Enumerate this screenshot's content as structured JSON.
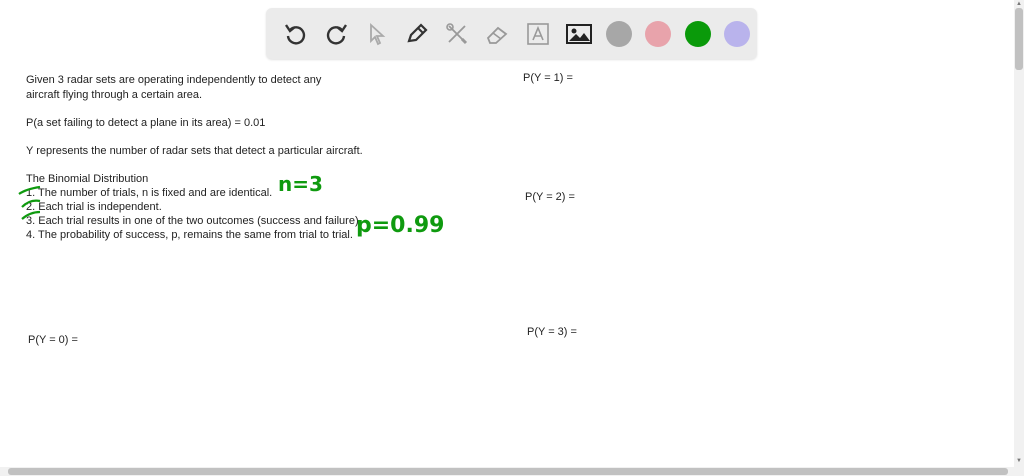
{
  "toolbar": {
    "tools": [
      "undo-icon",
      "redo-icon",
      "pointer-icon",
      "pencil-icon",
      "tools-icon",
      "eraser-icon",
      "text-icon",
      "image-icon"
    ],
    "colors": [
      "#a7a7a7",
      "#e8a3ab",
      "#0a9a0a",
      "#b9b3ec"
    ]
  },
  "content": {
    "intro_line1": "Given 3 radar sets are operating independently to detect any",
    "intro_line2": "aircraft flying through a certain area.",
    "prob_fail": "P(a set failing to detect a plane in its area) = 0.01",
    "y_def": "Y represents the number of radar sets that detect a particular aircraft.",
    "binomial_title": "The Binomial Distribution",
    "cond1": "1. The number of trials, n is fixed and are identical.",
    "cond2": "2. Each trial is independent.",
    "cond3": "3. Each trial results in one of the two outcomes (success and failure).",
    "cond4": "4. The probability of success, p, remains the same from trial to trial.",
    "py0": "P(Y = 0) =",
    "py1": "P(Y = 1) =",
    "py2": "P(Y = 2) =",
    "py3": "P(Y = 3) ="
  },
  "annotations": {
    "n_note": "n=3",
    "p_note": "p=0.99"
  }
}
